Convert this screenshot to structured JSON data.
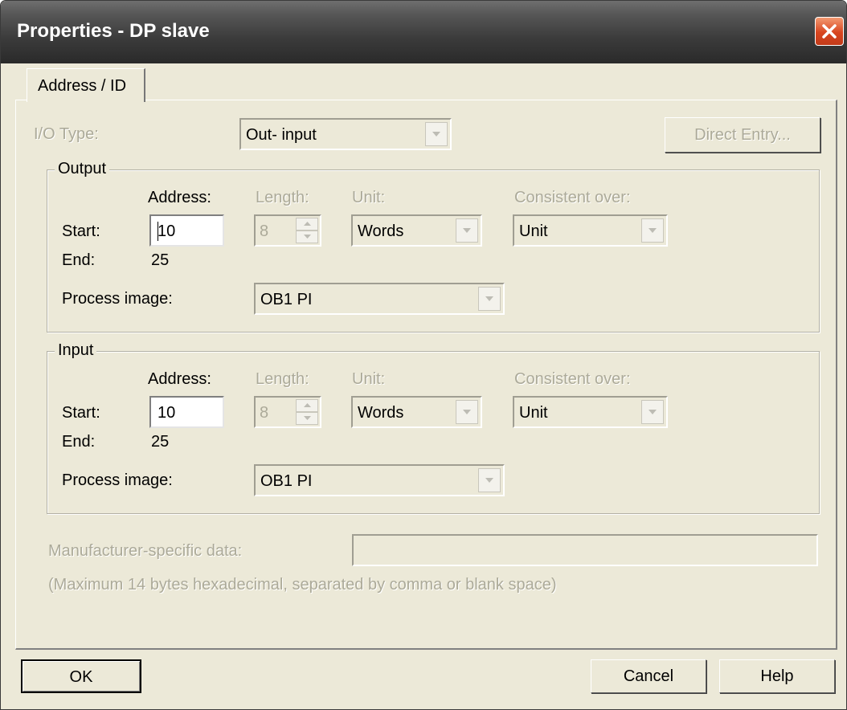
{
  "window": {
    "title": "Properties - DP slave"
  },
  "tabs": [
    {
      "label": "Address / ID"
    }
  ],
  "io_type": {
    "label": "I/O Type:",
    "value": "Out- input",
    "direct_entry": "Direct Entry..."
  },
  "headers": {
    "address": "Address:",
    "length": "Length:",
    "unit": "Unit:",
    "consistent": "Consistent over:"
  },
  "output": {
    "group": "Output",
    "start_label": "Start:",
    "start": "10",
    "end_label": "End:",
    "end": "25",
    "length": "8",
    "unit": "Words",
    "consistent": "Unit",
    "process_label": "Process image:",
    "process_image": "OB1 PI"
  },
  "input": {
    "group": "Input",
    "start_label": "Start:",
    "start": "10",
    "end_label": "End:",
    "end": "25",
    "length": "8",
    "unit": "Words",
    "consistent": "Unit",
    "process_label": "Process image:",
    "process_image": "OB1 PI"
  },
  "manufacturer": {
    "label": "Manufacturer-specific data:",
    "value": "",
    "hint": "(Maximum 14 bytes hexadecimal, separated by comma or blank space)"
  },
  "footer": {
    "ok": "OK",
    "cancel": "Cancel",
    "help": "Help"
  }
}
